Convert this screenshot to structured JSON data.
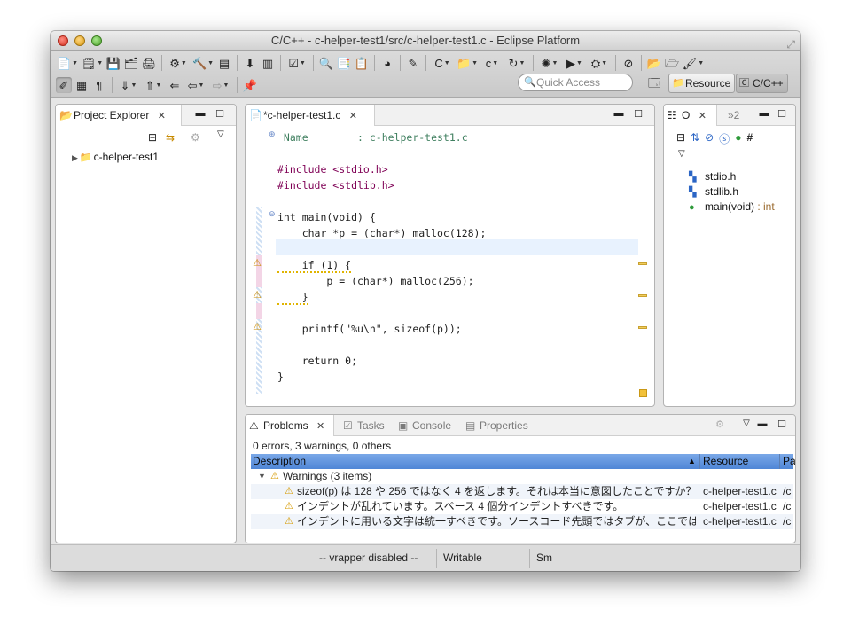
{
  "window": {
    "title": "C/C++ - c-helper-test1/src/c-helper-test1.c - Eclipse Platform"
  },
  "toolbar": {
    "quick_access_placeholder": "Quick Access",
    "perspectives": [
      {
        "label": "Resource"
      },
      {
        "label": "C/C++"
      }
    ]
  },
  "project_explorer": {
    "tab_label": "Project Explorer",
    "items": [
      {
        "label": "c-helper-test1"
      }
    ]
  },
  "editor": {
    "tab_label": "*c-helper-test1.c",
    "lines": [
      {
        "text": " Name        : c-helper-test1.c"
      },
      {
        "text": ""
      },
      {
        "text": "#include <stdio.h>"
      },
      {
        "text": "#include <stdlib.h>"
      },
      {
        "text": ""
      },
      {
        "text": "int main(void) {"
      },
      {
        "text": "    char *p = (char*) malloc(128);"
      },
      {
        "text": ""
      },
      {
        "text": "    if (1) {"
      },
      {
        "text": "        p = (char*) malloc(256);"
      },
      {
        "text": "    }"
      },
      {
        "text": ""
      },
      {
        "text": "    printf(\"%u\\n\", sizeof(p));"
      },
      {
        "text": ""
      },
      {
        "text": "    return 0;"
      },
      {
        "text": "}"
      }
    ]
  },
  "outline": {
    "tab_label": "O",
    "other_tab_label": "»2",
    "items": [
      {
        "label": "stdio.h",
        "icon": "include-icon"
      },
      {
        "label": "stdlib.h",
        "icon": "include-icon"
      },
      {
        "label": "main(void)",
        "type": " : int",
        "icon": "function-icon"
      }
    ]
  },
  "problems": {
    "tabs": [
      {
        "label": "Problems",
        "active": true
      },
      {
        "label": "Tasks"
      },
      {
        "label": "Console"
      },
      {
        "label": "Properties"
      }
    ],
    "summary": "0 errors, 3 warnings, 0 others",
    "columns": {
      "description": "Description",
      "resource": "Resource",
      "path": "Pa"
    },
    "group_label": "Warnings (3 items)",
    "rows": [
      {
        "description": "sizeof(p) は 128 や 256 ではなく 4 を返します。それは本当に意図したことですか？",
        "resource": "c-helper-test1.c",
        "path": "/c"
      },
      {
        "description": "インデントが乱れています。スペース 4 個分インデントすべきです。",
        "resource": "c-helper-test1.c",
        "path": "/c"
      },
      {
        "description": "インデントに用いる文字は統一すべきです。ソースコード先頭ではタブが、ここではスペ…",
        "resource": "c-helper-test1.c",
        "path": "/c"
      }
    ]
  },
  "statusbar": {
    "vrapper": "-- vrapper disabled --",
    "writable": "Writable",
    "insert_mode": "Sm"
  }
}
